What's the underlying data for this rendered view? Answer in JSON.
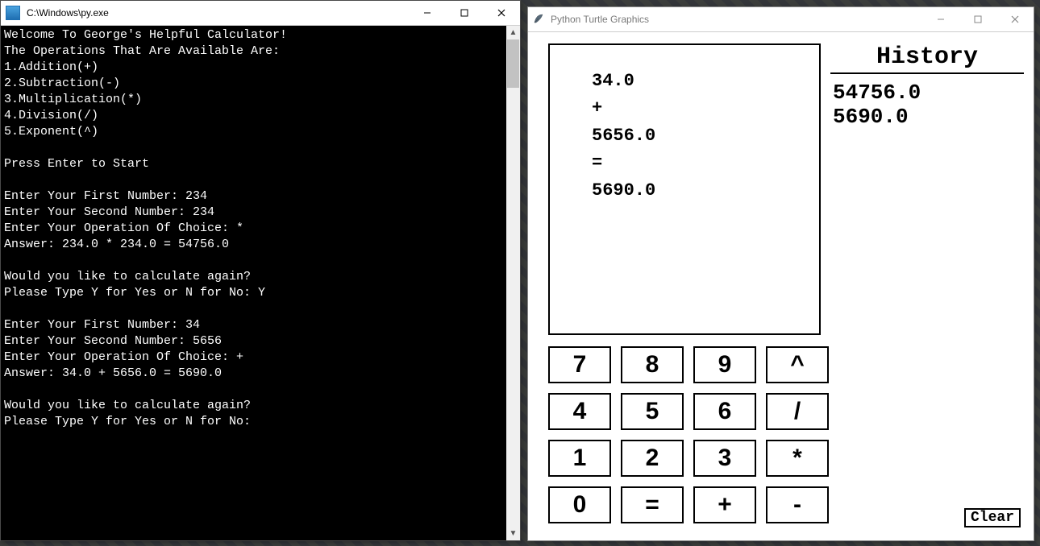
{
  "console": {
    "title": "C:\\Windows\\py.exe",
    "lines": [
      "Welcome To George's Helpful Calculator!",
      "The Operations That Are Available Are:",
      "1.Addition(+)",
      "2.Subtraction(-)",
      "3.Multiplication(*)",
      "4.Division(/)",
      "5.Exponent(^)",
      "",
      "Press Enter to Start",
      "",
      "Enter Your First Number: 234",
      "Enter Your Second Number: 234",
      "Enter Your Operation Of Choice: *",
      "Answer: 234.0 * 234.0 = 54756.0",
      "",
      "Would you like to calculate again?",
      "Please Type Y for Yes or N for No: Y",
      "",
      "Enter Your First Number: 34",
      "Enter Your Second Number: 5656",
      "Enter Your Operation Of Choice: +",
      "Answer: 34.0 + 5656.0 = 5690.0",
      "",
      "Would you like to calculate again?",
      "Please Type Y for Yes or N for No: "
    ]
  },
  "turtle": {
    "title": "Python Turtle Graphics",
    "display_lines": [
      "34.0",
      "+",
      "5656.0",
      "=",
      "5690.0"
    ],
    "history_title": "History",
    "history": [
      "54756.0",
      "5690.0"
    ],
    "clear_label": "Clear",
    "keys": [
      "7",
      "8",
      "9",
      "^",
      "4",
      "5",
      "6",
      "/",
      "1",
      "2",
      "3",
      "*",
      "0",
      "=",
      "+",
      "-"
    ]
  }
}
